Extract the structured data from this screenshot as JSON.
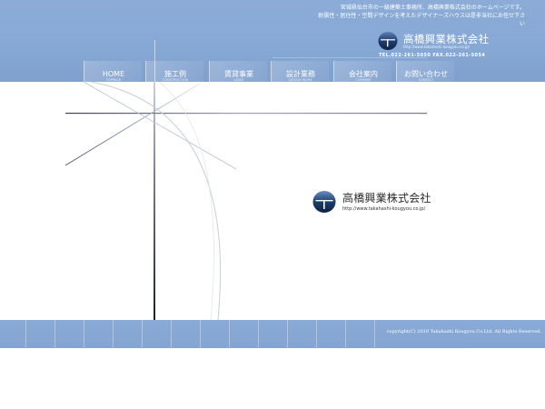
{
  "header": {
    "tagline_line1": "宮城県仙台市の一級建築士事務所、高橋興業株式会社のホームページです。",
    "tagline_line2": "耐震性・居住性・空間デザインを考えたデザイナーズハウスは是非当社にお任せ下さ",
    "tagline_line3": "い",
    "company_name": "高橋興業株式会社",
    "company_url": "http://www.takahashi-kougyou.co.jp/",
    "contact": "TEL.022-261-5050 FAX.022-261-5054"
  },
  "nav": [
    {
      "label": "HOME",
      "sub": "TOPPAGE"
    },
    {
      "label": "施工例",
      "sub": "CONSTRUCTION"
    },
    {
      "label": "賃貸事業",
      "sub": "LEASE"
    },
    {
      "label": "設計業務",
      "sub": "DESIGN WORK"
    },
    {
      "label": "会社案内",
      "sub": "COMPANY"
    },
    {
      "label": "お問い合わせ",
      "sub": "CONTACT"
    }
  ],
  "main": {
    "company_name": "高橋興業株式会社",
    "company_url": "http://www.takahashi-kougyou.co.jp/"
  },
  "footer": {
    "copyright": "copyright(C) 2010 Takahashi Kougyou Co.Ltd. All Rights Reserved."
  },
  "colors": {
    "header_bg": "#86a8d4",
    "footer_bg": "#86a8d4",
    "logo_dark": "#1d3f6e",
    "text_white": "#ffffff"
  },
  "icons": {
    "logo": "company-logo-icon"
  }
}
